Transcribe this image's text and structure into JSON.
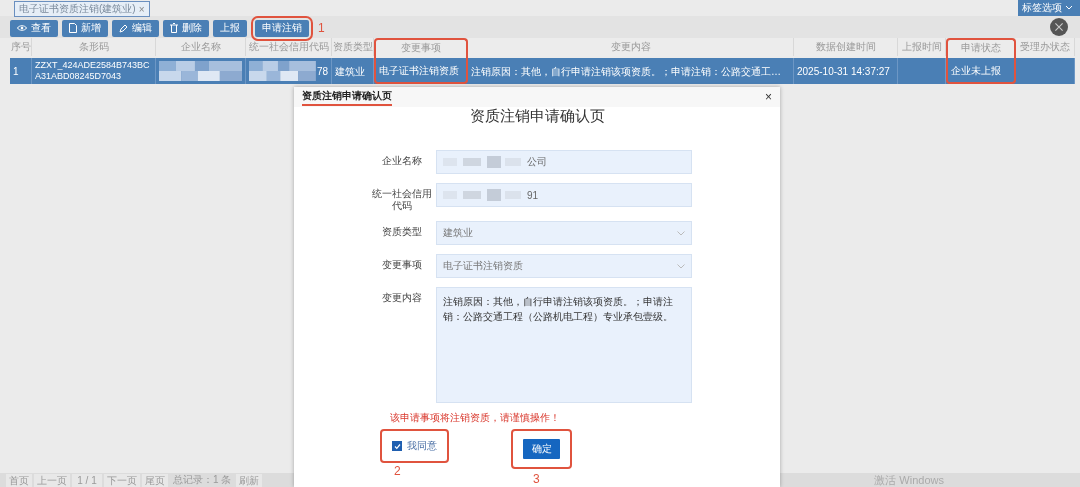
{
  "tab_strip": {
    "tabs": [
      {
        "label": "电子证书资质注销(建筑业)",
        "close": "×",
        "selected": true
      }
    ],
    "options_button": "标签选项"
  },
  "toolbar": [
    {
      "label": "查看",
      "kind": "eye",
      "highlighted": false
    },
    {
      "label": "新增",
      "kind": "doc",
      "highlighted": false
    },
    {
      "label": "编辑",
      "kind": "pen",
      "highlighted": false
    },
    {
      "label": "删除",
      "kind": "trash",
      "highlighted": false
    },
    {
      "label": "上报",
      "kind": "plain",
      "highlighted": false
    },
    {
      "label": "申请注销",
      "kind": "plain",
      "highlighted": true,
      "note": "1"
    }
  ],
  "table": {
    "columns": [
      {
        "label": "序号",
        "highlighted": false
      },
      {
        "label": "条形码",
        "highlighted": false
      },
      {
        "label": "企业名称",
        "highlighted": false
      },
      {
        "label": "统一社会信用代码",
        "highlighted": false
      },
      {
        "label": "资质类型",
        "highlighted": false
      },
      {
        "label": "变更事项",
        "highlighted": true
      },
      {
        "label": "变更内容",
        "highlighted": false
      },
      {
        "label": "数据创建时间",
        "highlighted": false
      },
      {
        "label": "上报时间",
        "highlighted": false
      },
      {
        "label": "申请状态",
        "highlighted": true
      },
      {
        "label": "受理办状态",
        "highlighted": false
      }
    ],
    "rows": [
      {
        "selected": true,
        "cells": [
          {
            "text": "1"
          },
          {
            "text": "ZZXT_424ADE2584B743BCA31ABD08245D7043"
          },
          {
            "redacted": true
          },
          {
            "text": "78",
            "redacted": true
          },
          {
            "text": "建筑业"
          },
          {
            "text": "电子证书注销资质"
          },
          {
            "text": "注销原因：其他，自行申请注销该项资质。；申请注销：公路交通工…"
          },
          {
            "text": "2025-10-31 14:37:27"
          },
          {},
          {
            "text": "企业未上报"
          },
          {}
        ]
      }
    ]
  },
  "pager": {
    "buttons": [
      "首页",
      "上一页",
      "1 / 1",
      "下一页",
      "尾页"
    ],
    "total": "总记录：1 条",
    "refresh": "刷新"
  },
  "os_notice": "激活 Windows",
  "dialog": {
    "title": "资质注销申请确认页",
    "title_underlined": true,
    "close": "×",
    "heading": "资质注销申请确认页",
    "fields": [
      {
        "label": "企业名称",
        "kind": "text",
        "value": "公司",
        "redacted": true
      },
      {
        "label": "统一社会信用代码",
        "kind": "text",
        "value": "91",
        "redacted": true
      },
      {
        "label": "资质类型",
        "kind": "select",
        "value": "建筑业"
      },
      {
        "label": "变更事项",
        "kind": "select",
        "value": "电子证书注销资质"
      },
      {
        "label": "变更内容",
        "kind": "textarea",
        "value": "注销原因：其他，自行申请注销该项资质。；申请注销：公路交通工程（公路机电工程）专业承包壹级。"
      }
    ],
    "warning": "该申请事项将注销资质，请谨慎操作！",
    "agree": {
      "label": "我同意",
      "checked": true,
      "highlighted": true,
      "note": "2"
    },
    "confirm": {
      "label": "确定",
      "highlighted": true,
      "note": "3"
    }
  }
}
